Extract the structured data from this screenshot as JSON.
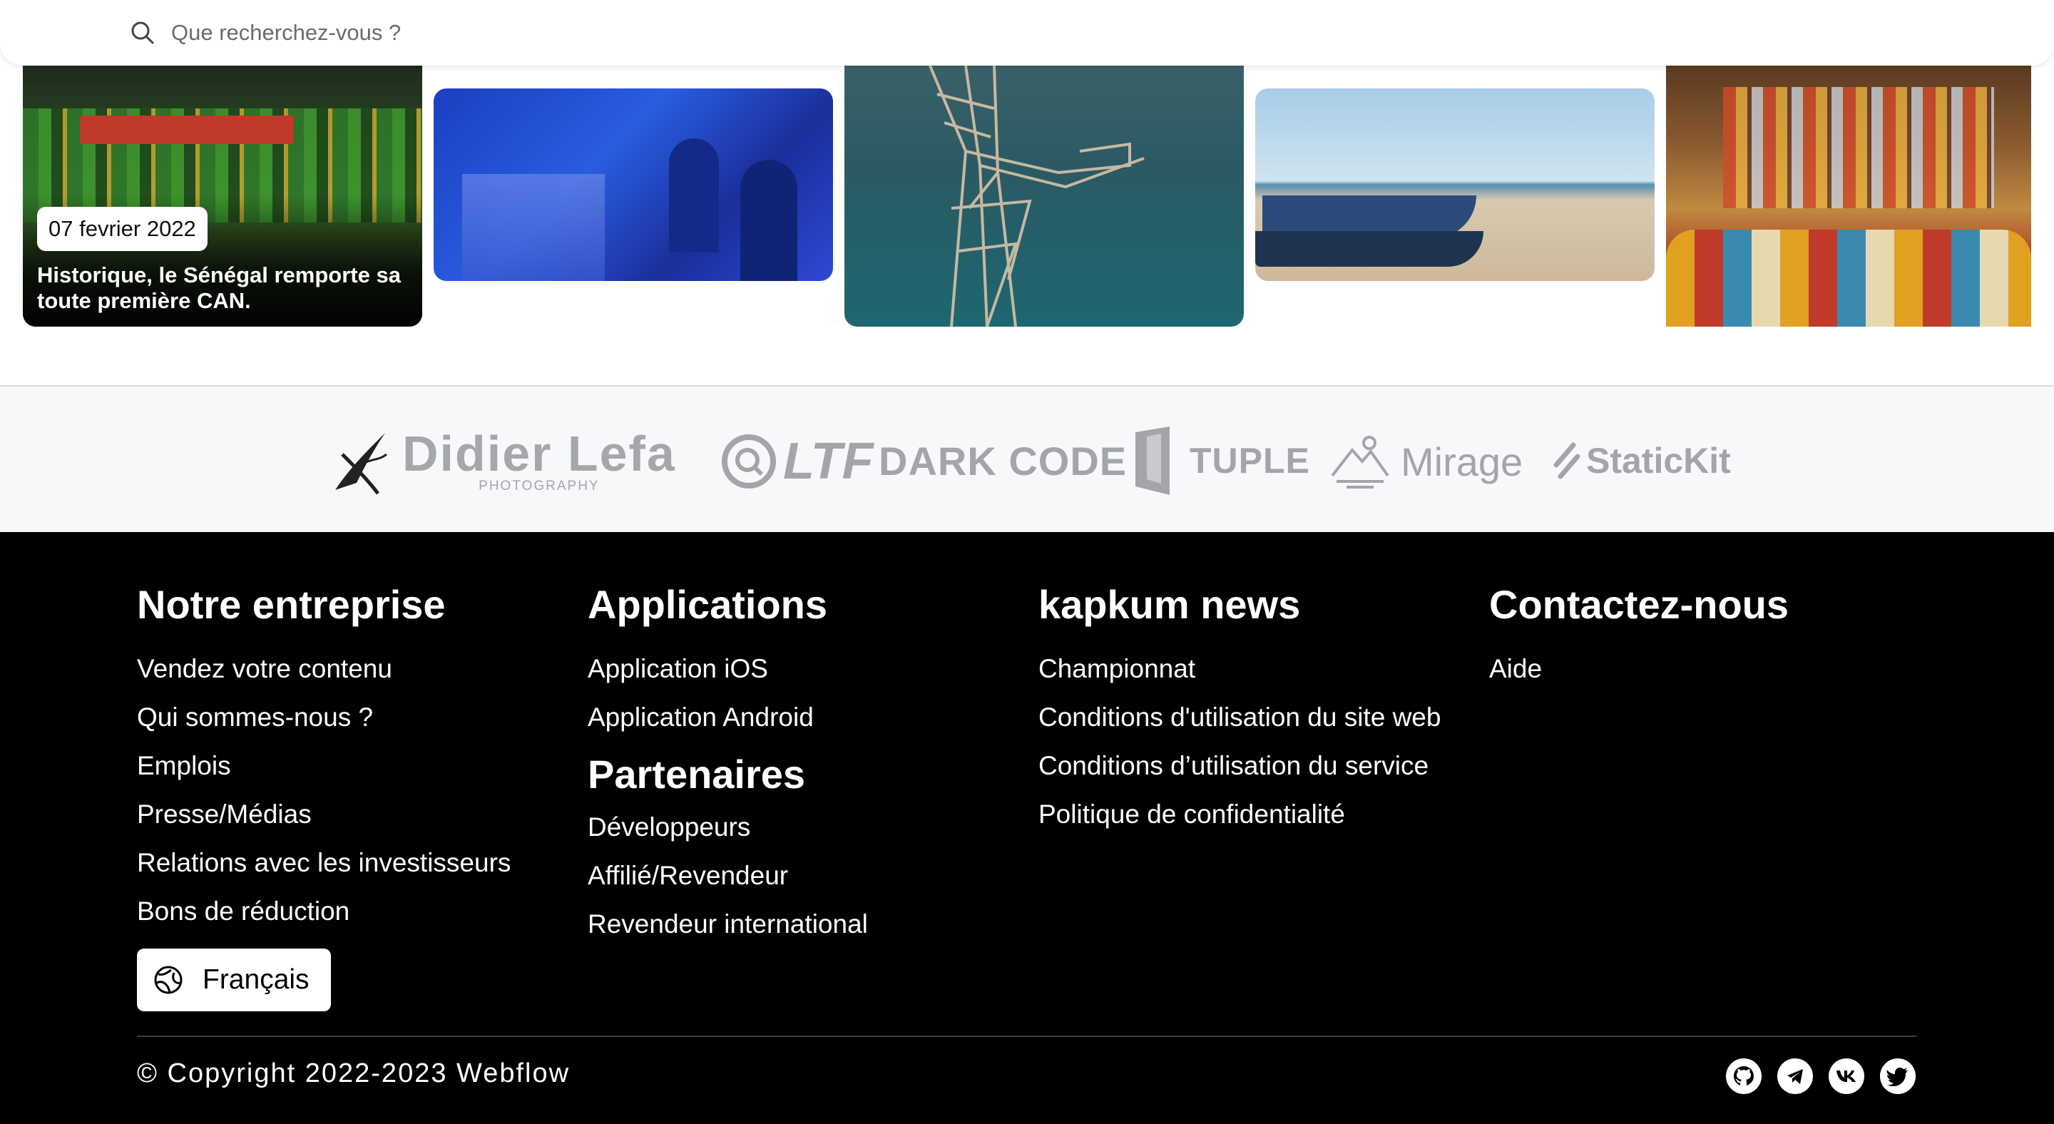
{
  "search": {
    "placeholder": "Que recherchez-vous ?",
    "icon": "search-icon"
  },
  "featured": {
    "date": "07 fevrier 2022",
    "title": "Historique, le Sénégal remporte sa toute première CAN."
  },
  "logos": {
    "didier_main": "Didier Lefa",
    "didier_sub": "PHOTOGRAPHY",
    "ltf": "LTF",
    "darkcode": "DARK CODE",
    "tuple": "TUPLE",
    "mirage": "Mirage",
    "statickit": "StaticKit"
  },
  "footer": {
    "columns": [
      {
        "heading": "Notre entreprise",
        "links": [
          "Vendez votre contenu",
          "Qui sommes-nous ?",
          "Emplois",
          "Presse/Médias",
          "Relations avec les investisseurs",
          "Bons de réduction"
        ]
      },
      {
        "heading": "Applications",
        "links": [
          "Application iOS",
          "Application Android"
        ],
        "sub_heading": "Partenaires",
        "sub_links": [
          "Développeurs",
          "Affilié/Revendeur",
          "Revendeur international"
        ]
      },
      {
        "heading": "kapkum news",
        "links": [
          "Championnat",
          "Conditions d'utilisation du site web",
          "Conditions d’utilisation du service",
          "Politique de confidentialité"
        ]
      },
      {
        "heading": "Contactez-nous",
        "links": [
          "Aide"
        ]
      }
    ],
    "language": "Français",
    "copyright": "© Copyright 2022-2023 Webflow",
    "socials": [
      "github-icon",
      "telegram-icon",
      "vk-icon",
      "twitter-icon"
    ]
  },
  "colors": {
    "footer_bg": "#000000",
    "logos_band_bg": "#f7f8fa",
    "logo_gray": "#a3a5ab"
  }
}
